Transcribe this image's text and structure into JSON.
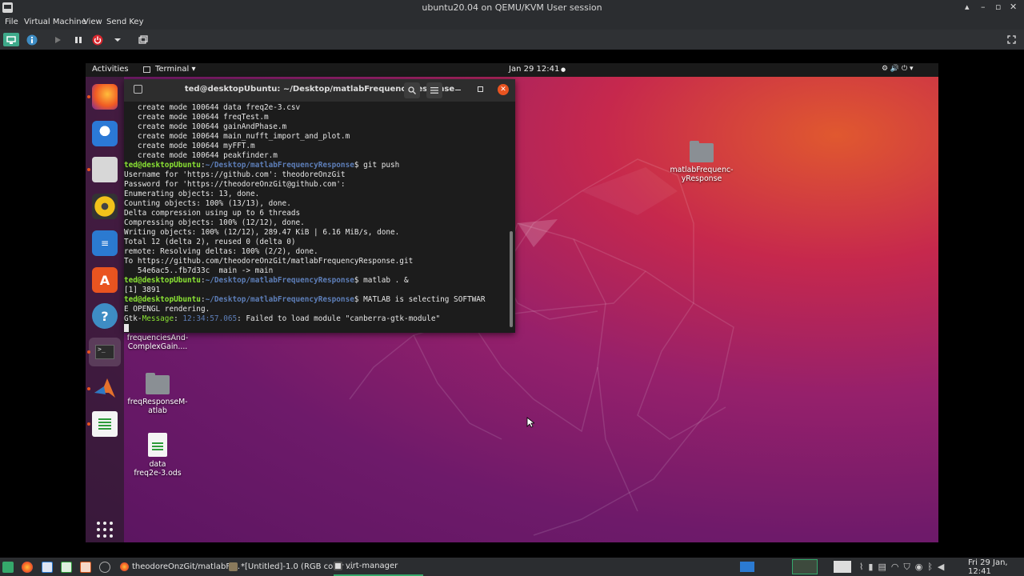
{
  "host_window": {
    "title": "ubuntu20.04 on QEMU/KVM User session",
    "controls": [
      "▴",
      "–",
      "▫",
      "✕"
    ]
  },
  "host_menu": [
    "File",
    "Virtual Machine",
    "View",
    "Send Key"
  ],
  "vm_toolbar": {
    "icons": [
      "console-icon",
      "info-icon",
      "run-icon",
      "pause-icon",
      "power-icon",
      "dropdown-icon",
      "snapshot-icon",
      "fullscreen-icon"
    ]
  },
  "gnome_topbar": {
    "activities": "Activities",
    "app_menu": "Terminal ▾",
    "clock": "Jan 29  12:41",
    "recording_dot": "●",
    "status_icons": "⚙  🔊  ⏻ ▾"
  },
  "dock": {
    "apps": [
      "firefox-icon",
      "thunderbird-icon",
      "files-icon",
      "rhythmbox-icon",
      "writer-icon",
      "software-icon",
      "help-icon",
      "terminal-icon",
      "matlab-icon",
      "calc-icon",
      "show-apps-icon"
    ]
  },
  "terminal": {
    "title": "ted@desktopUbuntu: ~/Desktop/matlabFrequencyResponse",
    "prompt_user": "ted@desktopUbuntu",
    "prompt_sep": ":",
    "prompt_path": "~/Desktop/matlabFrequencyResponse",
    "lines": {
      "l1": "   create mode 100644 data freq2e-3.csv",
      "l2": "   create mode 100644 freqTest.m",
      "l3": "   create mode 100644 gainAndPhase.m",
      "l4": "   create mode 100644 main_nufft_import_and_plot.m",
      "l5": "   create mode 100644 myFFT.m",
      "l6": "   create mode 100644 peakfinder.m",
      "cmd1": "$ git push",
      "l8": "Username for 'https://github.com': theodoreOnzGit",
      "l9": "Password for 'https://theodoreOnzGit@github.com':",
      "l10": "Enumerating objects: 13, done.",
      "l11": "Counting objects: 100% (13/13), done.",
      "l12": "Delta compression using up to 6 threads",
      "l13": "Compressing objects: 100% (12/12), done.",
      "l14": "Writing objects: 100% (12/12), 289.47 KiB | 6.16 MiB/s, done.",
      "l15": "Total 12 (delta 2), reused 0 (delta 0)",
      "l16": "remote: Resolving deltas: 100% (2/2), done.",
      "l17": "To https://github.com/theodoreOnzGit/matlabFrequencyResponse.git",
      "l18": "   54e6ac5..fb7d33c  main -> main",
      "cmd2": "$ matlab . &",
      "l20": "[1] 3891",
      "cmd3": "$ MATLAB is selecting SOFTWAR",
      "l22": "E OPENGL rendering.",
      "gtk_a": "Gtk-",
      "gtk_b": "Message",
      "gtk_c": ": ",
      "gtk_time": "12:34:57.065",
      "gtk_d": ": Failed to load module \"canberra-gtk-module\""
    }
  },
  "desktop_icons": {
    "i1": "matlabFrequenc-\nyResponse",
    "i2": "frequenciesAnd-\nComplexGain....",
    "i3": "freqResponseM-\natlab",
    "i4": "data\nfreq2e-3.ods"
  },
  "taskbar": {
    "task1": "theodoreOnzGit/matlabFr...",
    "task2": "*[Untitled]-1.0 (RGB color ...",
    "task3": "virt-manager",
    "clock": "Fri 29 Jan, 12:41"
  }
}
